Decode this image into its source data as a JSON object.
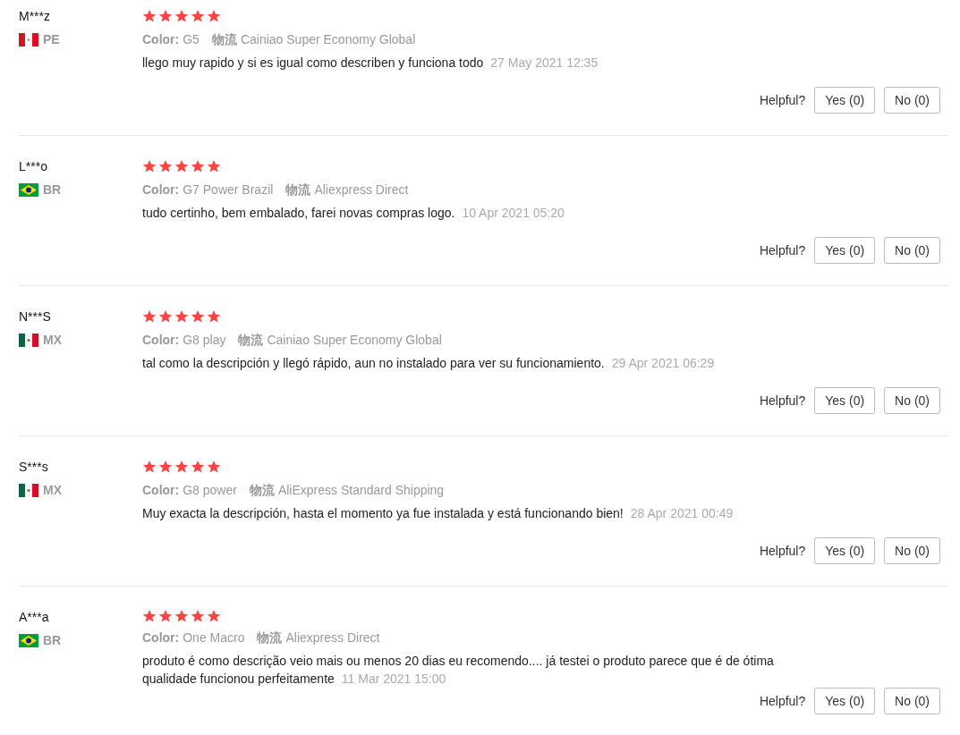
{
  "reviews": [
    {
      "name": "M***z",
      "kind": "pe",
      "country": "PE",
      "stars": 5,
      "variant_label": "Color:",
      "variant": "G5",
      "shipping_label": "物流",
      "shipping": "Cainiao Super Economy Global",
      "text": "llego muy rapido y si es igual como describen y funciona todo",
      "date": "27 May 2021 12:35",
      "helpful": "Helpful?",
      "yes": "Yes (0)",
      "no": "No (0)"
    },
    {
      "name": "L***o",
      "kind": "br",
      "country": "BR",
      "stars": 5,
      "variant_label": "Color:",
      "variant": "G7 Power Brazil",
      "shipping_label": "物流",
      "shipping": "Aliexpress Direct",
      "text": "tudo certinho, bem embalado, farei novas compras logo.",
      "date": "10 Apr 2021 05:20",
      "helpful": "Helpful?",
      "yes": "Yes (0)",
      "no": "No (0)"
    },
    {
      "name": "N***S",
      "kind": "mx",
      "country": "MX",
      "stars": 5,
      "variant_label": "Color:",
      "variant": "G8 play",
      "shipping_label": "物流",
      "shipping": "Cainiao Super Economy Global",
      "text": "tal como la descripción y llegó rápido, aun no instalado para ver su funcionamiento.",
      "date": "29 Apr 2021 06:29",
      "helpful": "Helpful?",
      "yes": "Yes (0)",
      "no": "No (0)"
    },
    {
      "name": "S***s",
      "kind": "mx",
      "country": "MX",
      "stars": 5,
      "variant_label": "Color:",
      "variant": "G8 power",
      "shipping_label": "物流",
      "shipping": "AliExpress Standard Shipping",
      "text": "Muy exacta la descripción, hasta el momento ya fue instalada y está funcionando bien!",
      "date": "28 Apr 2021 00:49",
      "helpful": "Helpful?",
      "yes": "Yes (0)",
      "no": "No (0)"
    },
    {
      "name": "A***a",
      "kind": "br",
      "country": "BR",
      "stars": 5,
      "variant_label": "Color:",
      "variant": "One Macro",
      "shipping_label": "物流",
      "shipping": "Aliexpress Direct",
      "text": "produto é como descrição veio mais ou menos 20 dias eu recomendo.... já testei o produto parece que é de ótima qualidade funcionou perfeitamente",
      "date": "11 Mar 2021 15:00",
      "helpful": "Helpful?",
      "yes": "Yes (0)",
      "no": "No (0)"
    }
  ]
}
